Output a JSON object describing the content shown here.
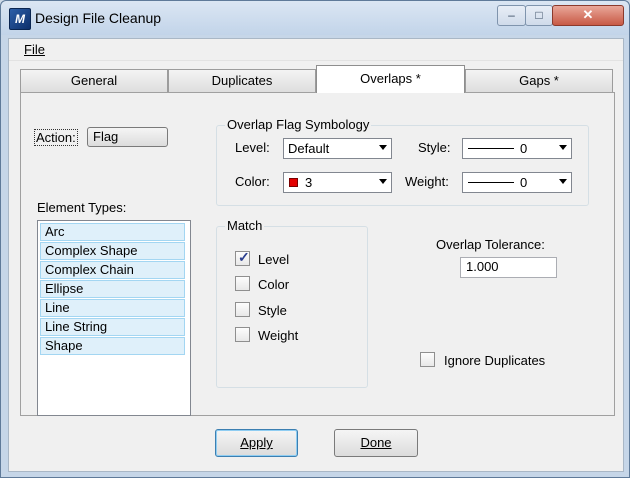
{
  "window": {
    "title": "Design File Cleanup",
    "icon": "microstation-icon",
    "close_glyph": "✕"
  },
  "menu": {
    "file": "File"
  },
  "tabs": [
    {
      "label": "General"
    },
    {
      "label": "Duplicates"
    },
    {
      "label": "Overlaps *",
      "active": true
    },
    {
      "label": "Gaps *"
    }
  ],
  "action": {
    "label": "Action:",
    "value": "Flag"
  },
  "element_types": {
    "label": "Element Types:",
    "items": [
      "Arc",
      "Complex Shape",
      "Complex Chain",
      "Ellipse",
      "Line",
      "Line String",
      "Shape"
    ]
  },
  "symbology": {
    "title": "Overlap Flag Symbology",
    "level_label": "Level:",
    "level_value": "Default",
    "style_label": "Style:",
    "style_value": "0",
    "color_label": "Color:",
    "color_value": "3",
    "color_swatch": "#e30000",
    "weight_label": "Weight:",
    "weight_value": "0"
  },
  "match": {
    "title": "Match",
    "options": [
      {
        "label": "Level",
        "checked": true
      },
      {
        "label": "Color",
        "checked": false
      },
      {
        "label": "Style",
        "checked": false
      },
      {
        "label": "Weight",
        "checked": false
      }
    ]
  },
  "tolerance": {
    "label": "Overlap Tolerance:",
    "value": "1.000"
  },
  "ignore_duplicates": {
    "label": "Ignore Duplicates",
    "checked": false
  },
  "buttons": {
    "apply": "Apply",
    "done": "Done"
  }
}
